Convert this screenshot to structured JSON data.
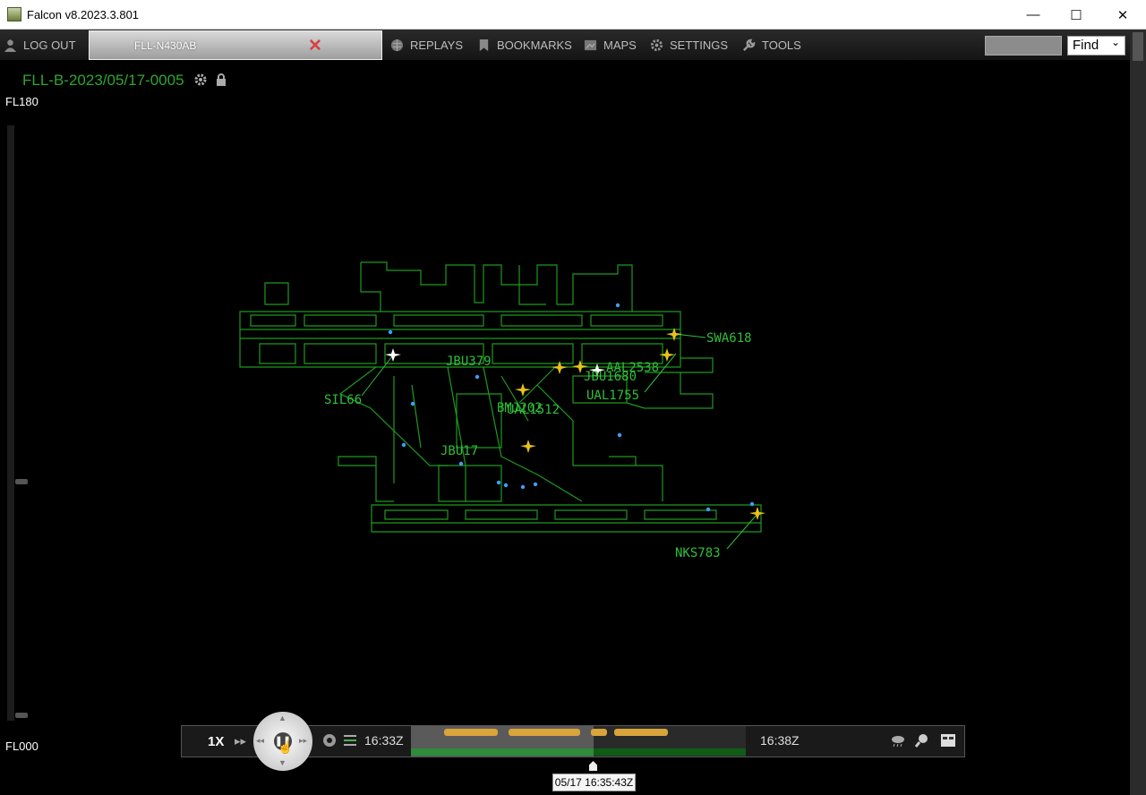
{
  "window": {
    "title": "Falcon v8.2023.3.801",
    "minimize": "—",
    "maximize": "☐",
    "close": "✕"
  },
  "toolbar": {
    "logout": "LOG OUT",
    "active_tab": "FLL-N430AB",
    "menu": [
      "REPLAYS",
      "BOOKMARKS",
      "MAPS",
      "SETTINGS",
      "TOOLS"
    ],
    "find_label": "Find",
    "find_caret": "⌄"
  },
  "view": {
    "title": "FLL-B-2023/05/17-0005",
    "altitude_top": "FL180",
    "altitude_bottom": "FL000"
  },
  "colors": {
    "map_line": "#1e9a1e",
    "callsign": "#2fbf3a",
    "aircraft_active": "#e8c21a",
    "aircraft_ghost": "#ffffff",
    "vehicle": "#3aa0ff"
  },
  "aircraft": [
    {
      "callsign": "SWA618",
      "icon": "plane-icon",
      "state": "yellow"
    },
    {
      "callsign": "JBU379",
      "icon": "plane-icon",
      "state": "yellow"
    },
    {
      "callsign": "AAL2538",
      "icon": "plane-icon",
      "state": "yellow"
    },
    {
      "callsign": "JBU1680",
      "icon": "plane-icon",
      "state": "white"
    },
    {
      "callsign": "UAL1755",
      "icon": "plane-icon",
      "state": "yellow"
    },
    {
      "callsign": "SIL66",
      "icon": "plane-icon",
      "state": "white"
    },
    {
      "callsign": "BMJ202",
      "icon": "plane-icon",
      "state": "yellow"
    },
    {
      "callsign": "UAL1512",
      "icon": "plane-icon",
      "state": "yellow"
    },
    {
      "callsign": "JBU17",
      "icon": "plane-icon",
      "state": "yellow"
    },
    {
      "callsign": "NKS783",
      "icon": "plane-icon",
      "state": "yellow"
    }
  ],
  "playback": {
    "speed": "1X",
    "start_time": "16:33Z",
    "end_time": "16:38Z",
    "cursor_time": "05/17 16:35:43Z",
    "progress": 0.55
  }
}
